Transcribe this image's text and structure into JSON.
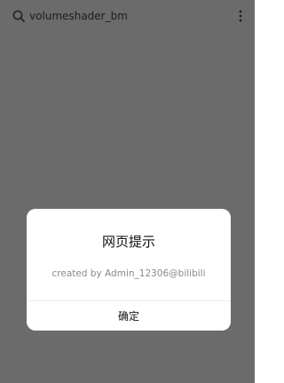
{
  "header": {
    "query": "volumeshader_bm",
    "search_icon": "search-icon",
    "more_icon": "more-vertical-icon"
  },
  "dialog": {
    "title": "网页提示",
    "message": "created by Admin_12306@bilibili",
    "confirm_label": "确定"
  },
  "colors": {
    "backdrop": "#6b6b6b",
    "dialog_bg": "#ffffff",
    "message_text": "#8a8a8a",
    "title_text": "#111111"
  }
}
